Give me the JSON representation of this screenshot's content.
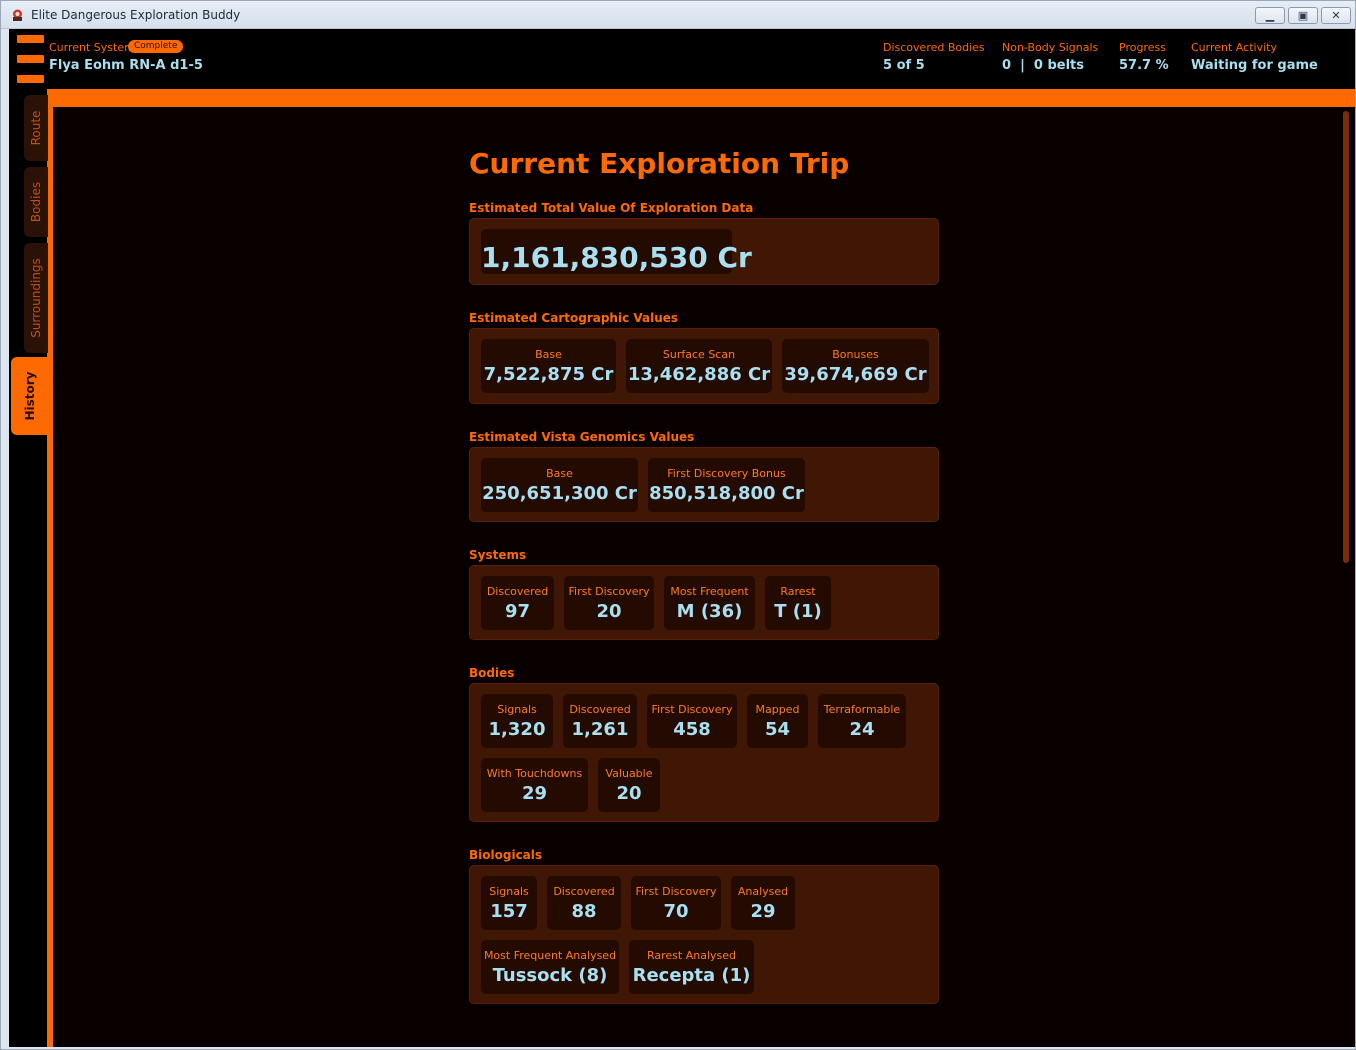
{
  "window": {
    "title": "Elite Dangerous Exploration Buddy"
  },
  "header": {
    "current_system_label": "Current System",
    "status_badge": "Complete",
    "system_name": "Flya Eohm RN-A d1-5",
    "discovered_bodies_label": "Discovered Bodies",
    "discovered_bodies_value": "5 of 5",
    "non_body_signals_label": "Non-Body Signals",
    "non_body_signals_value": "0  |  0 belts",
    "progress_label": "Progress",
    "progress_value": "57.7 %",
    "activity_label": "Current Activity",
    "activity_value": "Waiting for game"
  },
  "tabs": [
    "Route",
    "Bodies",
    "Surroundings",
    "History"
  ],
  "active_tab": "History",
  "page_title": "Current Exploration Trip",
  "total": {
    "title": "Estimated Total Value Of Exploration Data",
    "value": "1,161,830,530 Cr"
  },
  "cartographic": {
    "title": "Estimated Cartographic Values",
    "items": [
      {
        "label": "Base",
        "value": "7,522,875 Cr"
      },
      {
        "label": "Surface Scan",
        "value": "13,462,886 Cr"
      },
      {
        "label": "Bonuses",
        "value": "39,674,669 Cr"
      }
    ]
  },
  "genomics": {
    "title": "Estimated Vista Genomics Values",
    "items": [
      {
        "label": "Base",
        "value": "250,651,300 Cr"
      },
      {
        "label": "First Discovery Bonus",
        "value": "850,518,800 Cr"
      }
    ]
  },
  "systems": {
    "title": "Systems",
    "items": [
      {
        "label": "Discovered",
        "value": "97"
      },
      {
        "label": "First Discovery",
        "value": "20"
      },
      {
        "label": "Most Frequent",
        "value": "M (36)"
      },
      {
        "label": "Rarest",
        "value": "T (1)"
      }
    ]
  },
  "bodies": {
    "title": "Bodies",
    "items": [
      {
        "label": "Signals",
        "value": "1,320"
      },
      {
        "label": "Discovered",
        "value": "1,261"
      },
      {
        "label": "First Discovery",
        "value": "458"
      },
      {
        "label": "Mapped",
        "value": "54"
      },
      {
        "label": "Terraformable",
        "value": "24"
      },
      {
        "label": "With Touchdowns",
        "value": "29"
      },
      {
        "label": "Valuable",
        "value": "20"
      }
    ]
  },
  "biologicals": {
    "title": "Biologicals",
    "items": [
      {
        "label": "Signals",
        "value": "157"
      },
      {
        "label": "Discovered",
        "value": "88"
      },
      {
        "label": "First Discovery",
        "value": "70"
      },
      {
        "label": "Analysed",
        "value": "29"
      },
      {
        "label": "Most Frequent Analysed",
        "value": "Tussock (8)"
      },
      {
        "label": "Rarest Analysed",
        "value": "Recepta (1)"
      }
    ]
  },
  "colors": {
    "accent": "#ff6a00",
    "value_text": "#a9dff0",
    "panel": "#401705",
    "card": "#230b02"
  }
}
